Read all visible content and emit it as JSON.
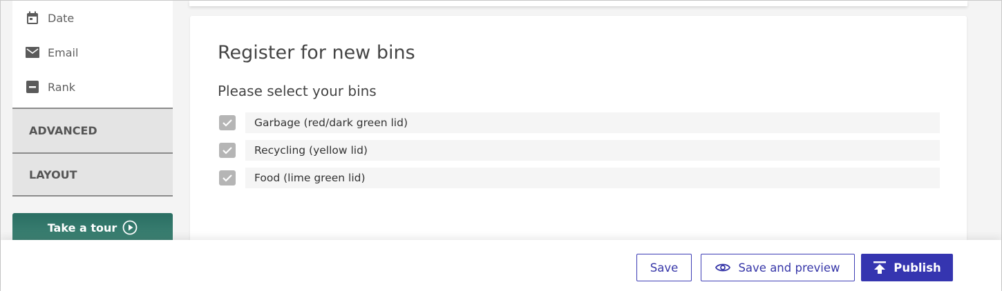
{
  "sidebar": {
    "fields": [
      {
        "label": "Date",
        "icon": "calendar-icon"
      },
      {
        "label": "Email",
        "icon": "envelope-icon"
      },
      {
        "label": "Rank",
        "icon": "minus-box-icon"
      }
    ],
    "sections": [
      {
        "label": "ADVANCED"
      },
      {
        "label": "LAYOUT"
      }
    ],
    "tour_button": {
      "label": "Take a tour",
      "icon": "play-circle-icon"
    }
  },
  "form": {
    "title": "Register for new bins",
    "question": "Please select your bins",
    "options": [
      {
        "label": "Garbage (red/dark green lid)",
        "checked": true
      },
      {
        "label": "Recycling (yellow lid)",
        "checked": true
      },
      {
        "label": "Food (lime green lid)",
        "checked": true
      }
    ]
  },
  "footer": {
    "save_label": "Save",
    "preview_label": "Save and preview",
    "preview_icon": "eye-icon",
    "publish_label": "Publish",
    "publish_icon": "upload-icon"
  },
  "colors": {
    "accent": "#3535b0",
    "tour_button": "#2a6e63",
    "checkbox": "#b5b5b5"
  }
}
